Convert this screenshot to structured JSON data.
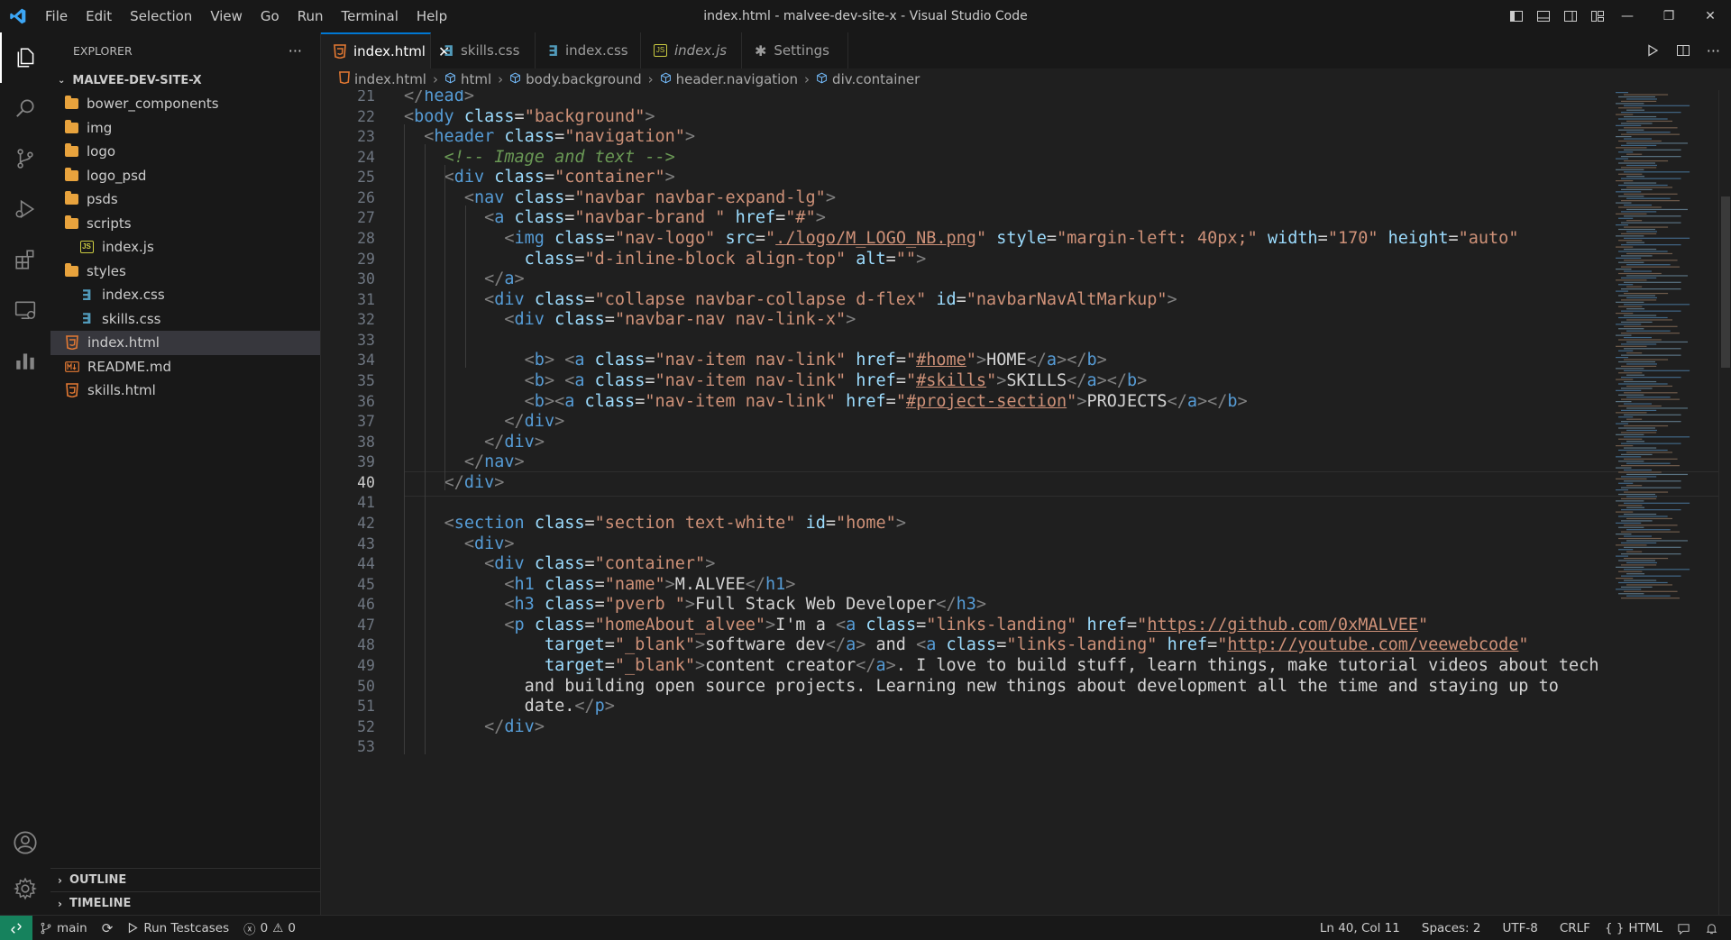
{
  "window": {
    "title": "index.html - malvee-dev-site-x - Visual Studio Code",
    "menu": [
      "File",
      "Edit",
      "Selection",
      "View",
      "Go",
      "Run",
      "Terminal",
      "Help"
    ]
  },
  "sidebar": {
    "title": "EXPLORER",
    "more": "···",
    "project": "MALVEE-DEV-SITE-X",
    "items": [
      {
        "label": "bower_components",
        "type": "folder",
        "depth": 0
      },
      {
        "label": "img",
        "type": "folder",
        "depth": 0
      },
      {
        "label": "logo",
        "type": "folder",
        "depth": 0
      },
      {
        "label": "logo_psd",
        "type": "folder",
        "depth": 0
      },
      {
        "label": "psds",
        "type": "folder",
        "depth": 0
      },
      {
        "label": "scripts",
        "type": "folder-open",
        "depth": 0
      },
      {
        "label": "index.js",
        "type": "js",
        "depth": 1
      },
      {
        "label": "styles",
        "type": "folder-open",
        "depth": 0
      },
      {
        "label": "index.css",
        "type": "css",
        "depth": 1
      },
      {
        "label": "skills.css",
        "type": "css",
        "depth": 1
      },
      {
        "label": "index.html",
        "type": "html",
        "depth": 0,
        "selected": true
      },
      {
        "label": "README.md",
        "type": "md",
        "depth": 0
      },
      {
        "label": "skills.html",
        "type": "html",
        "depth": 0
      }
    ],
    "outline": "OUTLINE",
    "timeline": "TIMELINE"
  },
  "tabs": [
    {
      "label": "index.html",
      "type": "html",
      "active": true,
      "close": "✕"
    },
    {
      "label": "skills.css",
      "type": "css"
    },
    {
      "label": "index.css",
      "type": "css"
    },
    {
      "label": "index.js",
      "type": "js",
      "italic": true
    },
    {
      "label": "Settings",
      "type": "settings"
    }
  ],
  "breadcrumb": [
    "index.html",
    "html",
    "body.background",
    "header.navigation",
    "div.container"
  ],
  "editor": {
    "current_line": 40,
    "lines": [
      {
        "n": 21,
        "html": "<span class='br'>&lt;/</span><span class='tag'>head</span><span class='br'>&gt;</span>"
      },
      {
        "n": 22,
        "html": "<span class='br'>&lt;</span><span class='tag'>body</span> <span class='atn'>class</span>=<span class='atv'>\"background\"</span><span class='br'>&gt;</span>"
      },
      {
        "n": 23,
        "html": "  <span class='br'>&lt;</span><span class='tag'>header</span> <span class='atn'>class</span>=<span class='atv'>\"navigation\"</span><span class='br'>&gt;</span>"
      },
      {
        "n": 24,
        "html": "    <span class='cmt'>&lt;!-- Image and text --&gt;</span>"
      },
      {
        "n": 25,
        "html": "    <span class='br'>&lt;</span><span class='tag'>div</span> <span class='atn'>class</span>=<span class='atv'>\"container\"</span><span class='br'>&gt;</span>"
      },
      {
        "n": 26,
        "html": "      <span class='br'>&lt;</span><span class='tag'>nav</span> <span class='atn'>class</span>=<span class='atv'>\"navbar navbar-expand-lg\"</span><span class='br'>&gt;</span>"
      },
      {
        "n": 27,
        "html": "        <span class='br'>&lt;</span><span class='tag'>a</span> <span class='atn'>class</span>=<span class='atv'>\"navbar-brand \"</span> <span class='atn'>href</span>=<span class='atv'>\"#\"</span><span class='br'>&gt;</span>"
      },
      {
        "n": 28,
        "html": "          <span class='br'>&lt;</span><span class='tag'>img</span> <span class='atn'>class</span>=<span class='atv'>\"nav-logo\"</span> <span class='atn'>src</span>=<span class='atv'>\"<span class='lnk'>./logo/M_LOGO_NB.png</span>\"</span> <span class='atn'>style</span>=<span class='atv'>\"margin-left: 40px;\"</span> <span class='atn'>width</span>=<span class='atv'>\"170\"</span> <span class='atn'>height</span>=<span class='atv'>\"auto\"</span>"
      },
      {
        "n": 29,
        "html": "            <span class='atn'>class</span>=<span class='atv'>\"d-inline-block align-top\"</span> <span class='atn'>alt</span>=<span class='atv'>\"\"</span><span class='br'>&gt;</span>"
      },
      {
        "n": 30,
        "html": "        <span class='br'>&lt;/</span><span class='tag'>a</span><span class='br'>&gt;</span>"
      },
      {
        "n": 31,
        "html": "        <span class='br'>&lt;</span><span class='tag'>div</span> <span class='atn'>class</span>=<span class='atv'>\"collapse navbar-collapse d-flex\"</span> <span class='atn'>id</span>=<span class='atv'>\"navbarNavAltMarkup\"</span><span class='br'>&gt;</span>"
      },
      {
        "n": 32,
        "html": "          <span class='br'>&lt;</span><span class='tag'>div</span> <span class='atn'>class</span>=<span class='atv'>\"navbar-nav nav-link-x\"</span><span class='br'>&gt;</span>"
      },
      {
        "n": 33,
        "html": ""
      },
      {
        "n": 34,
        "html": "            <span class='br'>&lt;</span><span class='tag'>b</span><span class='br'>&gt;</span> <span class='br'>&lt;</span><span class='tag'>a</span> <span class='atn'>class</span>=<span class='atv'>\"nav-item nav-link\"</span> <span class='atn'>href</span>=<span class='atv'>\"<span class='lnk'>#home</span>\"</span><span class='br'>&gt;</span><span class='txt'>HOME</span><span class='br'>&lt;/</span><span class='tag'>a</span><span class='br'>&gt;&lt;/</span><span class='tag'>b</span><span class='br'>&gt;</span>"
      },
      {
        "n": 35,
        "html": "            <span class='br'>&lt;</span><span class='tag'>b</span><span class='br'>&gt;</span> <span class='br'>&lt;</span><span class='tag'>a</span> <span class='atn'>class</span>=<span class='atv'>\"nav-item nav-link\"</span> <span class='atn'>href</span>=<span class='atv'>\"<span class='lnk'>#skills</span>\"</span><span class='br'>&gt;</span><span class='txt'>SKILLS</span><span class='br'>&lt;/</span><span class='tag'>a</span><span class='br'>&gt;&lt;/</span><span class='tag'>b</span><span class='br'>&gt;</span>"
      },
      {
        "n": 36,
        "html": "            <span class='br'>&lt;</span><span class='tag'>b</span><span class='br'>&gt;&lt;</span><span class='tag'>a</span> <span class='atn'>class</span>=<span class='atv'>\"nav-item nav-link\"</span> <span class='atn'>href</span>=<span class='atv'>\"<span class='lnk'>#project-section</span>\"</span><span class='br'>&gt;</span><span class='txt'>PROJECTS</span><span class='br'>&lt;/</span><span class='tag'>a</span><span class='br'>&gt;&lt;/</span><span class='tag'>b</span><span class='br'>&gt;</span>"
      },
      {
        "n": 37,
        "html": "          <span class='br'>&lt;/</span><span class='tag'>div</span><span class='br'>&gt;</span>"
      },
      {
        "n": 38,
        "html": "        <span class='br'>&lt;/</span><span class='tag'>div</span><span class='br'>&gt;</span>"
      },
      {
        "n": 39,
        "html": "      <span class='br'>&lt;/</span><span class='tag'>nav</span><span class='br'>&gt;</span>"
      },
      {
        "n": 40,
        "html": "    <span class='br'>&lt;/</span><span class='tag'>div</span><span class='br'>&gt;</span>"
      },
      {
        "n": 41,
        "html": ""
      },
      {
        "n": 42,
        "html": "    <span class='br'>&lt;</span><span class='tag'>section</span> <span class='atn'>class</span>=<span class='atv'>\"section text-white\"</span> <span class='atn'>id</span>=<span class='atv'>\"home\"</span><span class='br'>&gt;</span>"
      },
      {
        "n": 43,
        "html": "      <span class='br'>&lt;</span><span class='tag'>div</span><span class='br'>&gt;</span>"
      },
      {
        "n": 44,
        "html": "        <span class='br'>&lt;</span><span class='tag'>div</span> <span class='atn'>class</span>=<span class='atv'>\"container\"</span><span class='br'>&gt;</span>"
      },
      {
        "n": 45,
        "html": "          <span class='br'>&lt;</span><span class='tag'>h1</span> <span class='atn'>class</span>=<span class='atv'>\"name\"</span><span class='br'>&gt;</span><span class='txt'>M.ALVEE</span><span class='br'>&lt;/</span><span class='tag'>h1</span><span class='br'>&gt;</span>"
      },
      {
        "n": 46,
        "html": "          <span class='br'>&lt;</span><span class='tag'>h3</span> <span class='atn'>class</span>=<span class='atv'>\"pverb \"</span><span class='br'>&gt;</span><span class='txt'>Full Stack Web Developer</span><span class='br'>&lt;/</span><span class='tag'>h3</span><span class='br'>&gt;</span>"
      },
      {
        "n": 47,
        "html": "          <span class='br'>&lt;</span><span class='tag'>p</span> <span class='atn'>class</span>=<span class='atv'>\"homeAbout_alvee\"</span><span class='br'>&gt;</span><span class='txt'>I'm a </span><span class='br'>&lt;</span><span class='tag'>a</span> <span class='atn'>class</span>=<span class='atv'>\"links-landing\"</span> <span class='atn'>href</span>=<span class='atv'>\"<span class='lnk'>https://github.com/0xMALVEE</span>\"</span>"
      },
      {
        "n": 48,
        "html": "              <span class='atn'>target</span>=<span class='atv'>\"_blank\"</span><span class='br'>&gt;</span><span class='txt'>software dev</span><span class='br'>&lt;/</span><span class='tag'>a</span><span class='br'>&gt;</span><span class='txt'> and </span><span class='br'>&lt;</span><span class='tag'>a</span> <span class='atn'>class</span>=<span class='atv'>\"links-landing\"</span> <span class='atn'>href</span>=<span class='atv'>\"<span class='lnk'>http://youtube.com/veewebcode</span>\"</span>"
      },
      {
        "n": 49,
        "html": "              <span class='atn'>target</span>=<span class='atv'>\"_blank\"</span><span class='br'>&gt;</span><span class='txt'>content creator</span><span class='br'>&lt;/</span><span class='tag'>a</span><span class='br'>&gt;</span><span class='txt'>. I love to build stuff, learn things, make tutorial videos about tech</span>"
      },
      {
        "n": 50,
        "html": "            <span class='txt'>and building open source projects. Learning new things about development all the time and staying up to</span>"
      },
      {
        "n": 51,
        "html": "            <span class='txt'>date.</span><span class='br'>&lt;/</span><span class='tag'>p</span><span class='br'>&gt;</span>"
      },
      {
        "n": 52,
        "html": "        <span class='br'>&lt;/</span><span class='tag'>div</span><span class='br'>&gt;</span>"
      },
      {
        "n": 53,
        "html": ""
      }
    ]
  },
  "statusbar": {
    "remote_icon": "remote-icon",
    "branch": "main",
    "run_testcases": "Run Testcases",
    "errors": "0",
    "warnings": "0",
    "position": "Ln 40, Col 11",
    "spaces": "Spaces: 2",
    "encoding": "UTF-8",
    "eol": "CRLF",
    "language": "HTML"
  },
  "colors": {
    "accent": "#0078d4",
    "remote": "#16825d",
    "folder": "#e8a33d",
    "html_icon": "#e37933",
    "js_icon": "#cbcb41",
    "css_icon": "#519aba"
  }
}
